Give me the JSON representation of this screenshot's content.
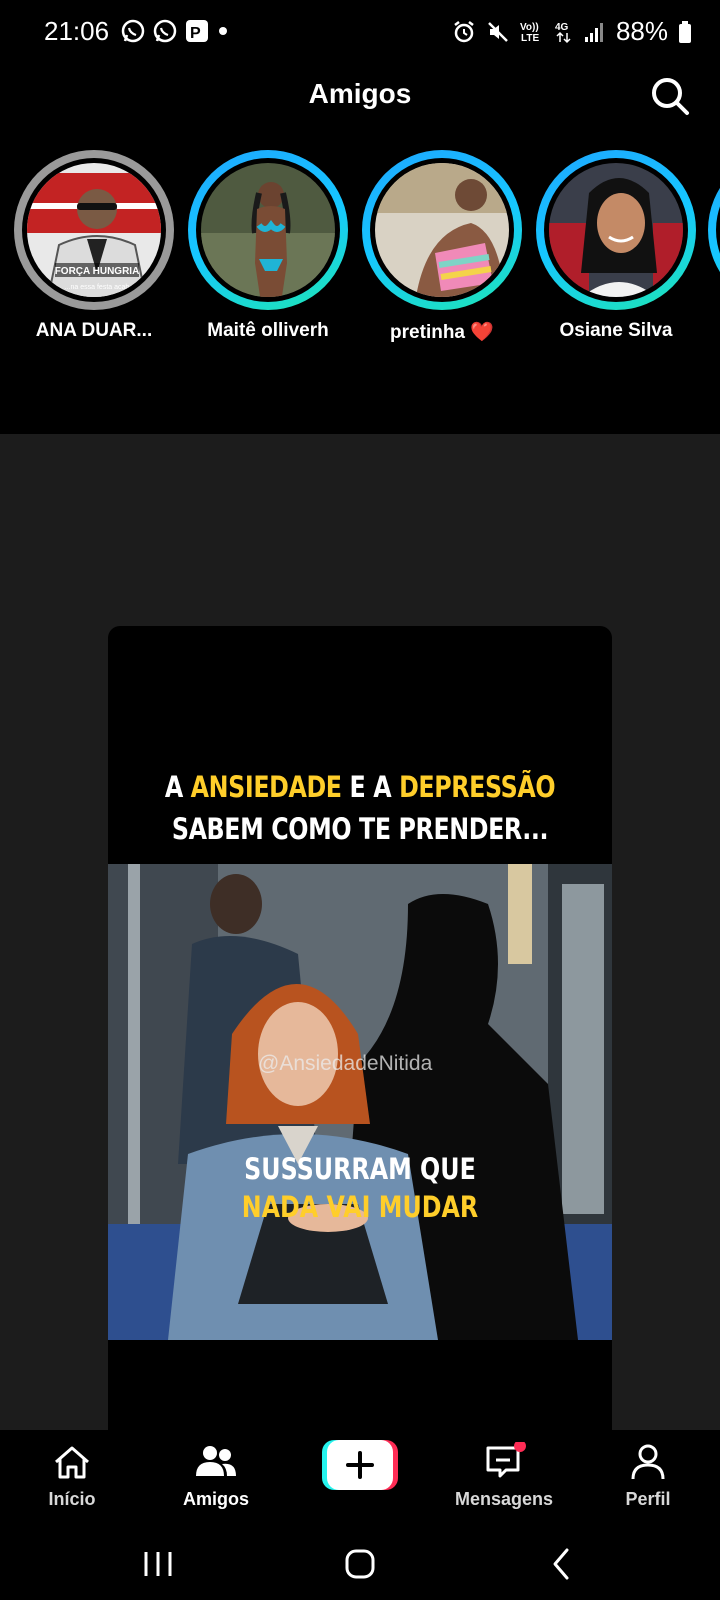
{
  "status_bar": {
    "time": "21:06",
    "battery": "88%",
    "network": "4G"
  },
  "header": {
    "title": "Amigos"
  },
  "stories": [
    {
      "name": "ANA DUAR...",
      "state": "seen"
    },
    {
      "name": "Maitê olliverh",
      "state": "unseen"
    },
    {
      "name": "pretinha ❤️",
      "state": "unseen"
    },
    {
      "name": "Osiane Silva",
      "state": "unseen"
    }
  ],
  "story_thumbnail": {
    "caption_top": "FORÇA HUNGRIA",
    "caption_bottom": "...na essa festa acab"
  },
  "video": {
    "caption_line1_a": "A ",
    "caption_line1_b": "ANSIEDADE",
    "caption_line1_c": " E A ",
    "caption_line1_d": "DEPRESSÃO",
    "caption_line2": "SABEM COMO TE PRENDER...",
    "watermark": "@AnsiedadeNitida",
    "caption_mid1": "SUSSURRAM QUE",
    "caption_mid2": "NADA VAI MUDAR"
  },
  "tabs": [
    {
      "label": "Início",
      "icon": "home-icon",
      "active": false
    },
    {
      "label": "Amigos",
      "icon": "friends-icon",
      "active": true
    },
    {
      "label": "Mensagens",
      "icon": "inbox-icon",
      "active": false,
      "badge": true
    },
    {
      "label": "Perfil",
      "icon": "profile-icon",
      "active": false
    }
  ],
  "colors": {
    "accent_yellow": "#ffce2a",
    "badge_red": "#fe2c55",
    "story_ring": "#1ea7ff",
    "create_cyan": "#25f4ee",
    "create_pink": "#fe2c55"
  }
}
